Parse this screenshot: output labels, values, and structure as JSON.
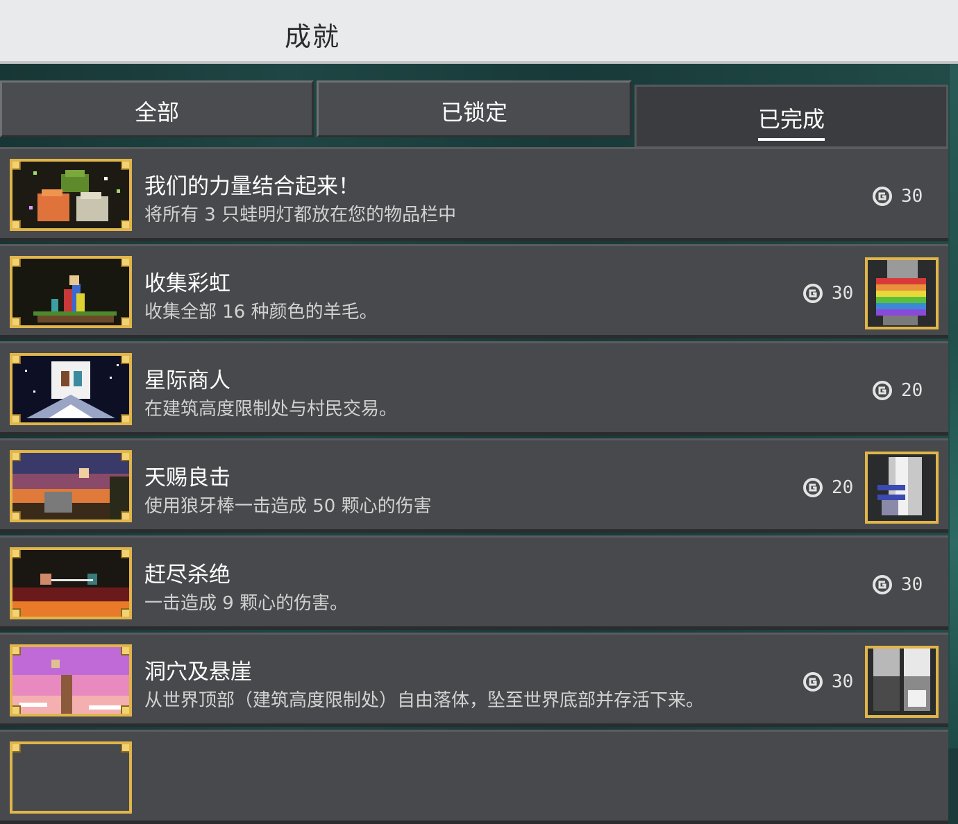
{
  "header": {
    "title": "成就"
  },
  "tabs": [
    {
      "label": "全部",
      "active": false
    },
    {
      "label": "已锁定",
      "active": false
    },
    {
      "label": "已完成",
      "active": true
    }
  ],
  "achievements": [
    {
      "name": "我们的力量结合起来！",
      "description": "将所有 3 只蛙明灯都放在您的物品栏中",
      "points": "30",
      "reward_icon": ""
    },
    {
      "name": "收集彩虹",
      "description": "收集全部 16 种颜色的羊毛。",
      "points": "30",
      "reward_icon": "rainbow-cape-icon"
    },
    {
      "name": "星际商人",
      "description": "在建筑高度限制处与村民交易。",
      "points": "20",
      "reward_icon": ""
    },
    {
      "name": "天赐良击",
      "description": "使用狼牙棒一击造成 50 颗心的伤害",
      "points": "20",
      "reward_icon": "armor-piece-icon"
    },
    {
      "name": "赶尽杀绝",
      "description": "一击造成 9 颗心的伤害。",
      "points": "30",
      "reward_icon": ""
    },
    {
      "name": "洞穴及悬崖",
      "description": "从世界顶部（建筑高度限制处）自由落体，坠至世界底部并存活下来。",
      "points": "30",
      "reward_icon": "boots-icon"
    }
  ],
  "colors": {
    "frame_gold": "#e0b54a",
    "row_bg": "#48494c",
    "topbar_bg": "#e9eaec"
  }
}
